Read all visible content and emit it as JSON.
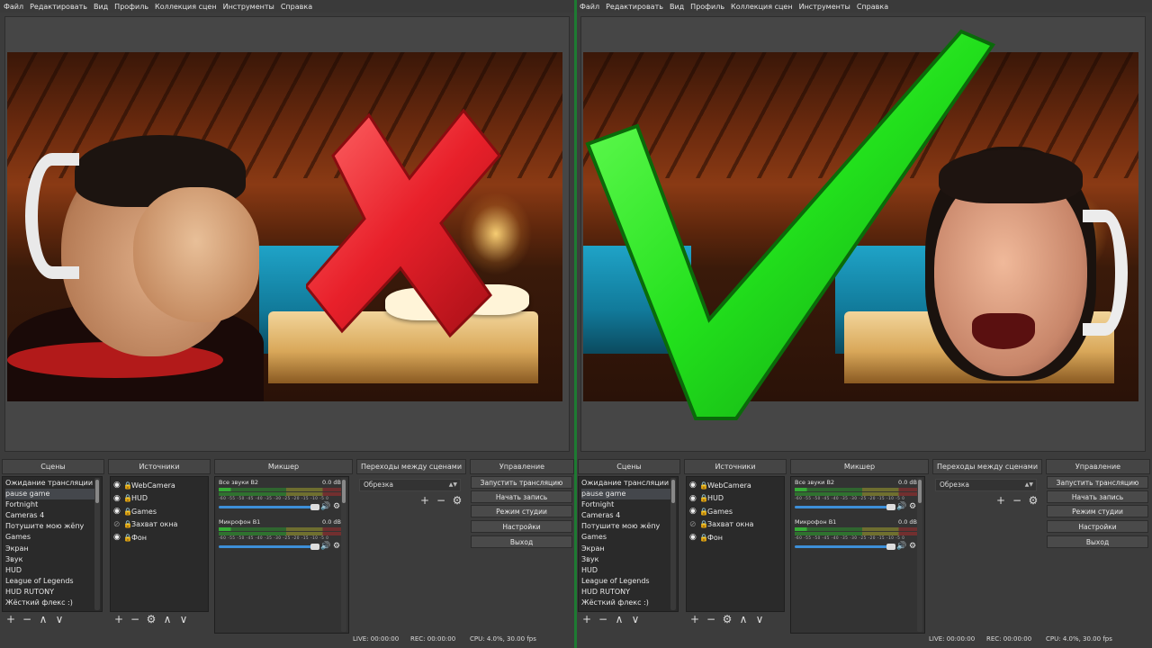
{
  "menu": [
    "Файл",
    "Редактировать",
    "Вид",
    "Профиль",
    "Коллекция сцен",
    "Инструменты",
    "Справка"
  ],
  "docks": {
    "scenes": "Сцены",
    "sources": "Источники",
    "mixer": "Микшер",
    "transitions": "Переходы между сценами",
    "controls": "Управление"
  },
  "scenes": [
    "Ожидание трансляции",
    "pause game",
    "Fortnight",
    "Cameras 4",
    "Потушите мою жёпу",
    "Games",
    "Экран",
    "Звук",
    "HUD",
    "League of Legends",
    "HUD RUTONY",
    "Жёсткий флекс :)"
  ],
  "selected_scene_index": 1,
  "sources": [
    "WebCamera",
    "HUD",
    "Games",
    "Захват окна",
    "Фон"
  ],
  "mixer": [
    {
      "name": "Все звуки В2",
      "db": "0.0 dB"
    },
    {
      "name": "Микрофон В1",
      "db": "0.0 dB"
    }
  ],
  "meter_ticks": "-60 -55 -50 -45 -40 -35 -30 -25 -20 -15 -10 -5 0",
  "transition": "Обрезка",
  "controls": [
    "Запустить трансляцию",
    "Начать запись",
    "Режим студии",
    "Настройки",
    "Выход"
  ],
  "status": {
    "live": "LIVE: 00:00:00",
    "rec": "REC: 00:00:00",
    "cpu": "CPU: 4.0%, 30.00 fps"
  },
  "colors": {
    "accent_green": "#22e01c",
    "cross_red": "#e8202a",
    "panel": "#2a2a2a",
    "bg": "#3c3c3c"
  },
  "icons": {
    "add": "+",
    "remove": "−",
    "gear": "⚙",
    "up": "∧",
    "down": "∨",
    "eye": "◉",
    "lock": "🔒",
    "speaker": "🔊"
  }
}
